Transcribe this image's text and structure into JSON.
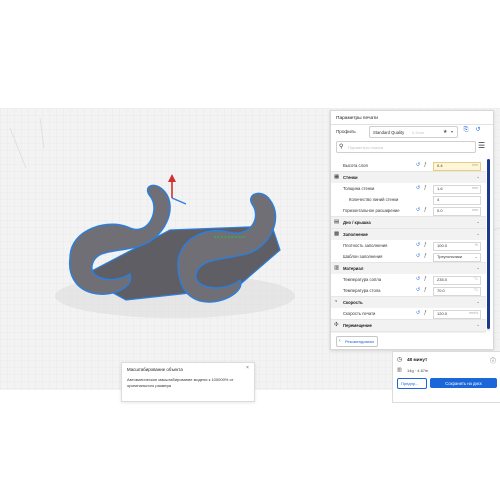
{
  "colors": {
    "accent": "#1b66d8",
    "model_body": "#6f6f75",
    "model_outline": "#2a7fe0",
    "build_plate": "#f3f3f3",
    "save_button": "#1b66d8"
  },
  "print_settings": {
    "title": "Параметры печати",
    "profile_label": "Профиль",
    "profile_value": "Standard Quality",
    "profile_hint": "0.2mm",
    "search_placeholder": "Параметры поиска",
    "rows": [
      {
        "kind": "setting",
        "label": "Высота слоя",
        "value": "0.4",
        "unit": "mm",
        "highlight": true
      },
      {
        "kind": "category",
        "label": "Стенки",
        "icon": "walls-icon"
      },
      {
        "kind": "setting",
        "label": "Толщина стенки",
        "value": "1.6",
        "unit": "mm"
      },
      {
        "kind": "setting",
        "label": "Количество линий стенки",
        "value": "4",
        "unit": "",
        "indent": true
      },
      {
        "kind": "setting",
        "label": "Горизонтальное расширение",
        "value": "0.0",
        "unit": "mm"
      },
      {
        "kind": "category",
        "label": "Дно / крышка",
        "icon": "top-bottom-icon"
      },
      {
        "kind": "category",
        "label": "Заполнение",
        "icon": "infill-icon"
      },
      {
        "kind": "setting",
        "label": "Плотность заполнения",
        "value": "100.0",
        "unit": "%"
      },
      {
        "kind": "setting",
        "label": "Шаблон заполнения",
        "value": "Треугольники",
        "unit": "",
        "dropdown": true
      },
      {
        "kind": "category",
        "label": "Материал",
        "icon": "material-icon"
      },
      {
        "kind": "setting",
        "label": "Температура сопла",
        "value": "235.0",
        "unit": "°C"
      },
      {
        "kind": "setting",
        "label": "Температура стола",
        "value": "70.0",
        "unit": "°C"
      },
      {
        "kind": "category",
        "label": "Скорость",
        "icon": "speed-icon"
      },
      {
        "kind": "setting",
        "label": "Скорость печати",
        "value": "120.0",
        "unit": "mm/s"
      },
      {
        "kind": "category",
        "label": "Перемещение",
        "icon": "travel-icon"
      },
      {
        "kind": "category",
        "label": "Охлаждение",
        "icon": "cooling-icon"
      }
    ],
    "recommended_button": "Рекомендовано"
  },
  "scaling_popup": {
    "title": "Масштабирование объекта",
    "message": "Автоматическое масштабирование модели к 100000% от оригинального размера"
  },
  "job_summary": {
    "print_time": "48 минут",
    "material": "14g · 4.67m",
    "preview_button": "Предпр...",
    "save_button": "Сохранить на диск"
  }
}
